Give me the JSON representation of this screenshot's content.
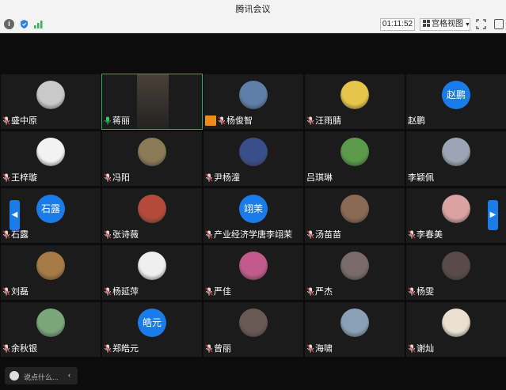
{
  "window": {
    "title": "腾讯会议"
  },
  "toolbar": {
    "timer": "01:11:52",
    "view_label": "宫格视图",
    "info_icon": "info-icon",
    "shield_icon": "shield-icon",
    "signal_icon": "signal-icon",
    "fullscreen_icon": "fullscreen-icon",
    "sidebar_icon": "sidebar-toggle-icon"
  },
  "participants": [
    {
      "name": "盛中原",
      "avatar": "photo",
      "color": "#c9c9c9",
      "mic": "muted"
    },
    {
      "name": "蒋丽",
      "avatar": "video",
      "color": "#4a4137",
      "mic": "active"
    },
    {
      "name": "杨俊智",
      "avatar": "photo",
      "color": "#5e7fa8",
      "mic": "muted",
      "badge": "orange"
    },
    {
      "name": "汪雨腈",
      "avatar": "photo",
      "color": "#e6c64a",
      "mic": "muted"
    },
    {
      "name": "赵鹏",
      "avatar": "text",
      "avatar_text": "赵鹏",
      "mic": "none"
    },
    {
      "name": "王梓璇",
      "avatar": "photo",
      "color": "#f2f2f2",
      "mic": "muted"
    },
    {
      "name": "冯阳",
      "avatar": "photo",
      "color": "#8a7a55",
      "mic": "muted"
    },
    {
      "name": "尹杨潼",
      "avatar": "photo",
      "color": "#3a4f8a",
      "mic": "muted"
    },
    {
      "name": "吕琪琳",
      "avatar": "photo",
      "color": "#5a9a4a",
      "mic": "none"
    },
    {
      "name": "李颖佩",
      "avatar": "photo",
      "color": "#9aa6b6",
      "mic": "none"
    },
    {
      "name": "石露",
      "avatar": "text",
      "avatar_text": "石露",
      "mic": "muted"
    },
    {
      "name": "张诗薇",
      "avatar": "photo",
      "color": "#b34a3a",
      "mic": "muted"
    },
    {
      "name": "产业经济学唐李翊茉",
      "avatar": "text",
      "avatar_text": "翊茉",
      "mic": "muted"
    },
    {
      "name": "汤苗苗",
      "avatar": "photo",
      "color": "#8a6a55",
      "mic": "muted"
    },
    {
      "name": "李春美",
      "avatar": "photo",
      "color": "#d9a3a3",
      "mic": "muted"
    },
    {
      "name": "刘磊",
      "avatar": "photo",
      "color": "#a67a45",
      "mic": "muted"
    },
    {
      "name": "杨延萍",
      "avatar": "photo",
      "color": "#efefef",
      "mic": "muted"
    },
    {
      "name": "严佳",
      "avatar": "photo",
      "color": "#c25a8a",
      "mic": "muted"
    },
    {
      "name": "严杰",
      "avatar": "photo",
      "color": "#7a6a6a",
      "mic": "muted"
    },
    {
      "name": "杨雯",
      "avatar": "photo",
      "color": "#5a4a4a",
      "mic": "muted"
    },
    {
      "name": "余秋银",
      "avatar": "photo",
      "color": "#7aa67a",
      "mic": "muted"
    },
    {
      "name": "郑皓元",
      "avatar": "text",
      "avatar_text": "皓元",
      "mic": "muted"
    },
    {
      "name": "曾丽",
      "avatar": "photo",
      "color": "#6a5a55",
      "mic": "muted"
    },
    {
      "name": "海啸",
      "avatar": "photo",
      "color": "#8aa0b6",
      "mic": "muted"
    },
    {
      "name": "谢灿",
      "avatar": "photo",
      "color": "#e9e0d0",
      "mic": "muted"
    }
  ],
  "chat": {
    "placeholder": "说点什么...",
    "collapse_icon": "chevron-left-icon"
  },
  "nav": {
    "prev_icon": "chevron-left-icon",
    "next_icon": "chevron-right-icon"
  }
}
